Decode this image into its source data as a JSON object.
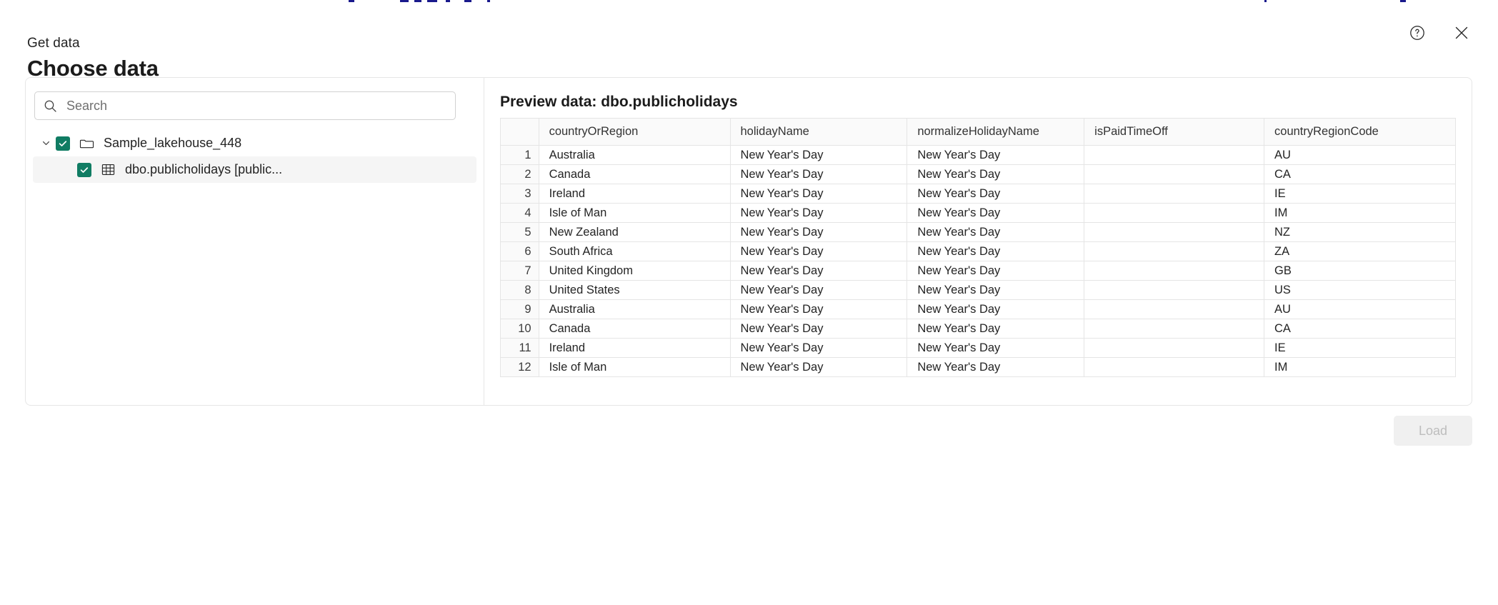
{
  "window": {
    "eyebrow": "Get data",
    "title": "Choose data"
  },
  "header": {
    "help_label": "Help",
    "close_label": "Close",
    "help_icon": "help-circle-icon",
    "close_icon": "close-icon"
  },
  "search": {
    "placeholder": "Search",
    "value": "",
    "icon": "search-icon"
  },
  "tree": {
    "items": [
      {
        "label": "Sample_lakehouse_448",
        "icon": "folder-icon",
        "checked": true,
        "expanded": true,
        "selected": false,
        "level": 0
      },
      {
        "label": "dbo.publicholidays [public...",
        "icon": "table-icon",
        "checked": true,
        "expanded": null,
        "selected": true,
        "level": 1
      }
    ]
  },
  "preview": {
    "title": "Preview data: dbo.publicholidays",
    "columns": [
      "",
      "countryOrRegion",
      "holidayName",
      "normalizeHolidayName",
      "isPaidTimeOff",
      "countryRegionCode"
    ],
    "rows": [
      [
        "1",
        "Australia",
        "New Year's Day",
        "New Year's Day",
        "",
        "AU"
      ],
      [
        "2",
        "Canada",
        "New Year's Day",
        "New Year's Day",
        "",
        "CA"
      ],
      [
        "3",
        "Ireland",
        "New Year's Day",
        "New Year's Day",
        "",
        "IE"
      ],
      [
        "4",
        "Isle of Man",
        "New Year's Day",
        "New Year's Day",
        "",
        "IM"
      ],
      [
        "5",
        "New Zealand",
        "New Year's Day",
        "New Year's Day",
        "",
        "NZ"
      ],
      [
        "6",
        "South Africa",
        "New Year's Day",
        "New Year's Day",
        "",
        "ZA"
      ],
      [
        "7",
        "United Kingdom",
        "New Year's Day",
        "New Year's Day",
        "",
        "GB"
      ],
      [
        "8",
        "United States",
        "New Year's Day",
        "New Year's Day",
        "",
        "US"
      ],
      [
        "9",
        "Australia",
        "New Year's Day",
        "New Year's Day",
        "",
        "AU"
      ],
      [
        "10",
        "Canada",
        "New Year's Day",
        "New Year's Day",
        "",
        "CA"
      ],
      [
        "11",
        "Ireland",
        "New Year's Day",
        "New Year's Day",
        "",
        "IE"
      ],
      [
        "12",
        "Isle of Man",
        "New Year's Day",
        "New Year's Day",
        "",
        "IM"
      ]
    ]
  },
  "footer": {
    "load_label": "Load",
    "load_disabled": true
  },
  "colors": {
    "checkbox_green": "#107c63",
    "text_primary": "#242424",
    "border": "#e6e6e6",
    "row_selected": "#f5f5f5",
    "header_bg": "#fafafa",
    "disabled_button_bg": "#f0f0f0",
    "disabled_button_text": "#bdbdbd"
  }
}
